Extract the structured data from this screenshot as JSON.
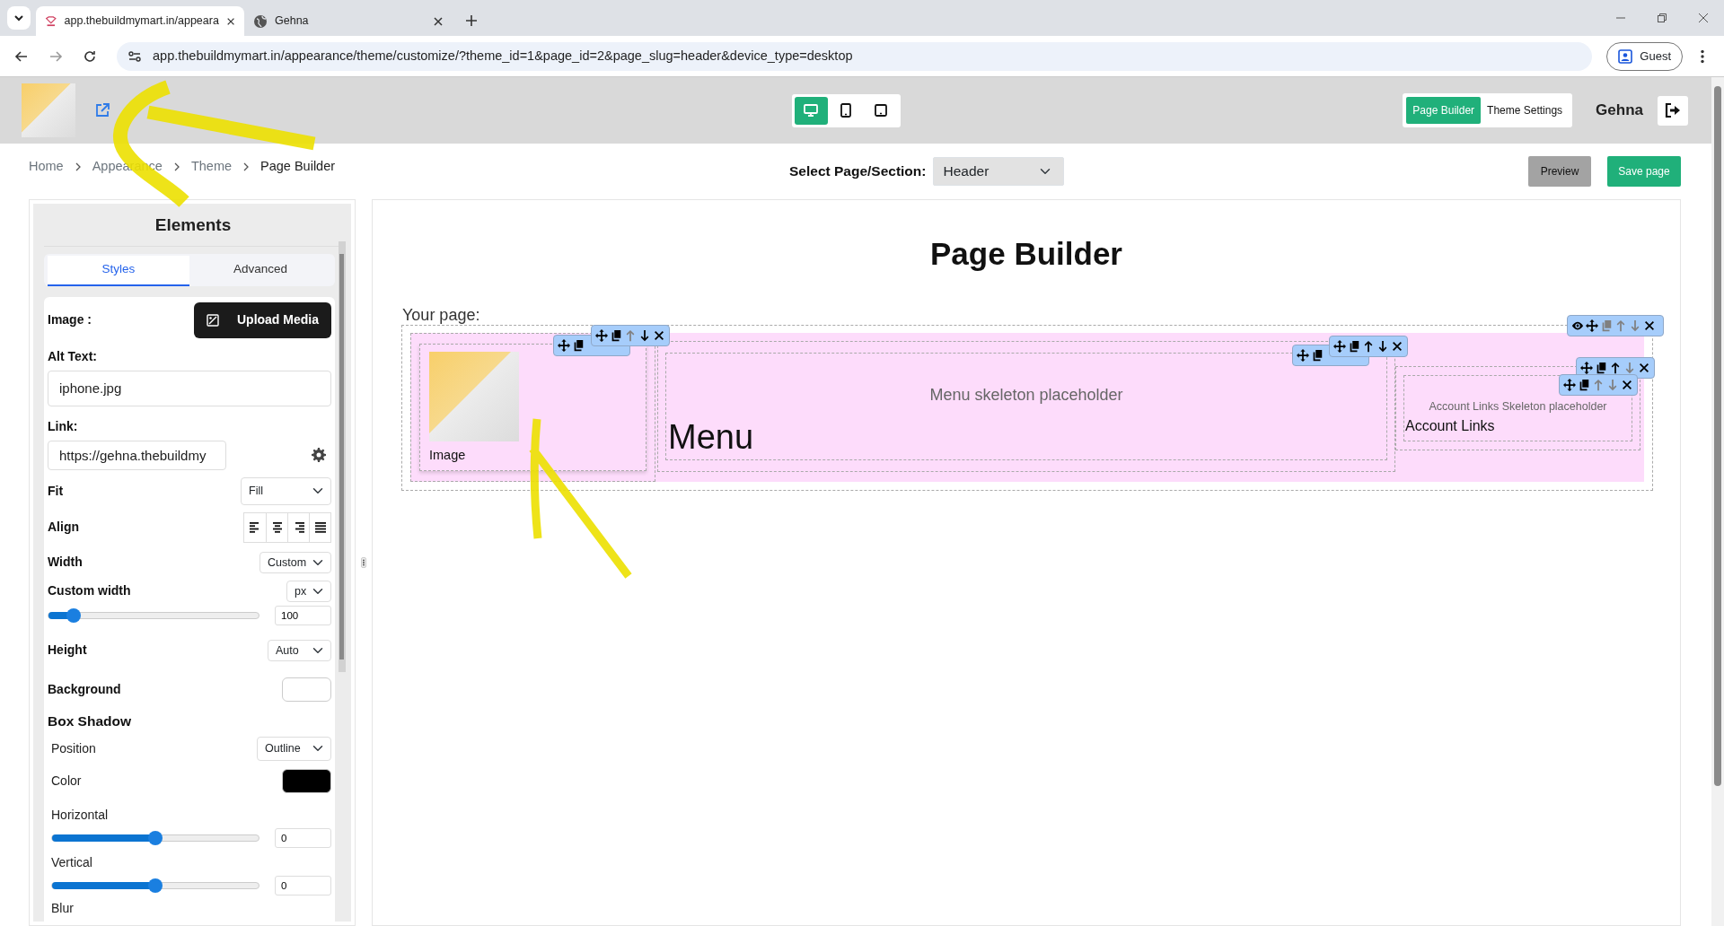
{
  "browser": {
    "tabs": [
      {
        "title": "app.thebuildmymart.in/appeara",
        "selected": true
      },
      {
        "title": "Gehna",
        "selected": false
      }
    ],
    "url": "app.thebuildmymart.in/appearance/theme/customize/?theme_id=1&page_id=2&page_slug=header&device_type=desktop",
    "profile": "Guest"
  },
  "header": {
    "devices": [
      {
        "kind": "desktop",
        "selected": true
      },
      {
        "kind": "tablet",
        "selected": false
      },
      {
        "kind": "mobile",
        "selected": false
      }
    ],
    "modes": [
      {
        "label": "Page Builder",
        "selected": true
      },
      {
        "label": "Theme Settings",
        "selected": false
      }
    ],
    "user": "Gehna"
  },
  "breadcrumb": [
    "Home",
    "Appearance",
    "Theme",
    "Page Builder"
  ],
  "page_select": {
    "label": "Select Page/Section:",
    "value": "Header"
  },
  "actions": [
    {
      "label": "Preview",
      "kind": "secondary"
    },
    {
      "label": "Save page",
      "kind": "primary"
    }
  ],
  "elements_panel": {
    "title": "Elements",
    "tabs": [
      {
        "label": "Styles",
        "selected": true
      },
      {
        "label": "Advanced",
        "selected": false
      }
    ],
    "image_label": "Image :",
    "upload_button": "Upload Media",
    "alt_text": {
      "label": "Alt Text:",
      "value": "iphone.jpg"
    },
    "link": {
      "label": "Link:",
      "value": "https://gehna.thebuildmy"
    },
    "fit": {
      "label": "Fit",
      "value": "Fill"
    },
    "align": {
      "label": "Align",
      "options": [
        {
          "kind": "left"
        },
        {
          "kind": "center"
        },
        {
          "kind": "right"
        },
        {
          "kind": "justify"
        }
      ]
    },
    "width": {
      "label": "Width",
      "value": "Custom"
    },
    "custom_width": {
      "label": "Custom width",
      "unit": "px",
      "level": 0.12,
      "value": "100"
    },
    "height": {
      "label": "Height",
      "value": "Auto"
    },
    "background": {
      "label": "Background",
      "color": "#ffffff"
    },
    "box_shadow": {
      "title": "Box Shadow",
      "position": {
        "label": "Position",
        "value": "Outline"
      },
      "color": {
        "label": "Color",
        "color": "#000000"
      },
      "horizontal": {
        "label": "Horizontal",
        "level": 0.5,
        "value": "0"
      },
      "vertical": {
        "label": "Vertical",
        "level": 0.5,
        "value": "0"
      },
      "blur": {
        "label": "Blur"
      }
    }
  },
  "canvas": {
    "title": "Page Builder",
    "subtitle": "Your page:",
    "section_toolbar": {
      "tools": [
        {
          "kind": "eye",
          "disabled": false
        },
        {
          "kind": "move",
          "disabled": false
        },
        {
          "kind": "copy",
          "disabled": true
        },
        {
          "kind": "up",
          "disabled": true
        },
        {
          "kind": "down",
          "disabled": true
        },
        {
          "kind": "close",
          "disabled": false
        }
      ]
    },
    "blocks": [
      {
        "kind": "image",
        "caption": "Image",
        "toolbars": [
          {
            "tools": [
              {
                "kind": "move",
                "disabled": false
              },
              {
                "kind": "copy",
                "disabled": false
              }
            ]
          },
          {
            "tools": [
              {
                "kind": "move",
                "disabled": false
              },
              {
                "kind": "copy",
                "disabled": false
              },
              {
                "kind": "up",
                "disabled": true
              },
              {
                "kind": "down",
                "disabled": false
              },
              {
                "kind": "close",
                "disabled": false
              }
            ]
          }
        ]
      },
      {
        "kind": "menu",
        "placeholder": "Menu skeleton placeholder",
        "label": "Menu",
        "toolbars": [
          {
            "tools": [
              {
                "kind": "move",
                "disabled": false
              },
              {
                "kind": "copy",
                "disabled": false
              }
            ]
          },
          {
            "tools": [
              {
                "kind": "move",
                "disabled": false
              },
              {
                "kind": "copy",
                "disabled": false
              },
              {
                "kind": "up",
                "disabled": false
              },
              {
                "kind": "down",
                "disabled": false
              },
              {
                "kind": "close",
                "disabled": false
              }
            ]
          }
        ]
      },
      {
        "kind": "account_links",
        "placeholder": "Account Links Skeleton placeholder",
        "label": "Account Links",
        "toolbars": [
          {
            "tools": [
              {
                "kind": "move",
                "disabled": false
              },
              {
                "kind": "copy",
                "disabled": false
              },
              {
                "kind": "up",
                "disabled": false
              },
              {
                "kind": "down",
                "disabled": true
              },
              {
                "kind": "close",
                "disabled": false
              }
            ]
          },
          {
            "tools": [
              {
                "kind": "move",
                "disabled": false
              },
              {
                "kind": "copy",
                "disabled": false
              },
              {
                "kind": "up",
                "disabled": true
              },
              {
                "kind": "down",
                "disabled": true
              },
              {
                "kind": "close",
                "disabled": false
              }
            ]
          }
        ]
      }
    ]
  }
}
